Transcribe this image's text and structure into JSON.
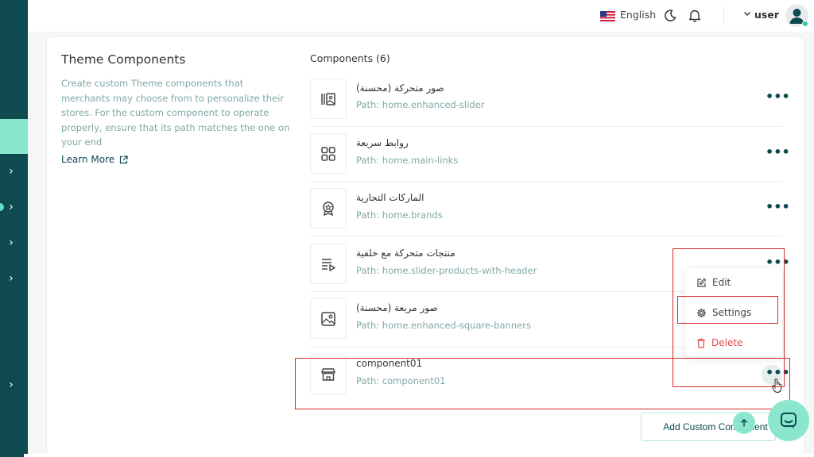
{
  "topbar": {
    "language": "English",
    "user": "user"
  },
  "section": {
    "title": "Theme Components",
    "description": "Create custom Theme components that merchants may choose from to personalize their stores. For the custom component to operate properly, ensure that its path matches the one on your end",
    "learn_more": "Learn More"
  },
  "components": {
    "title": "Components (6)",
    "items": [
      {
        "name": "صور متحركة (محسنة)",
        "path": "Path: home.enhanced-slider",
        "icon": "gallery-icon"
      },
      {
        "name": "روابط سريعة",
        "path": "Path: home.main-links",
        "icon": "grid-icon"
      },
      {
        "name": "الماركات التجارية",
        "path": "Path: home.brands",
        "icon": "badge-icon"
      },
      {
        "name": "منتجات متحركة مع خلفية",
        "path": "Path: home.slider-products-with-header",
        "icon": "playlist-icon"
      },
      {
        "name": "صور مربعة (محسنة)",
        "path": "Path: home.enhanced-square-banners",
        "icon": "image-icon"
      },
      {
        "name": "component01",
        "path": "Path: component01",
        "icon": "store-icon"
      }
    ]
  },
  "menu": {
    "edit": "Edit",
    "settings": "Settings",
    "delete": "Delete"
  },
  "actions": {
    "add_custom": "Add Custom Component"
  },
  "colors": {
    "brand_dark": "#0e4a4f",
    "brand_light": "#8ae6cc",
    "danger": "#e04848",
    "muted": "#7fa8a8"
  }
}
